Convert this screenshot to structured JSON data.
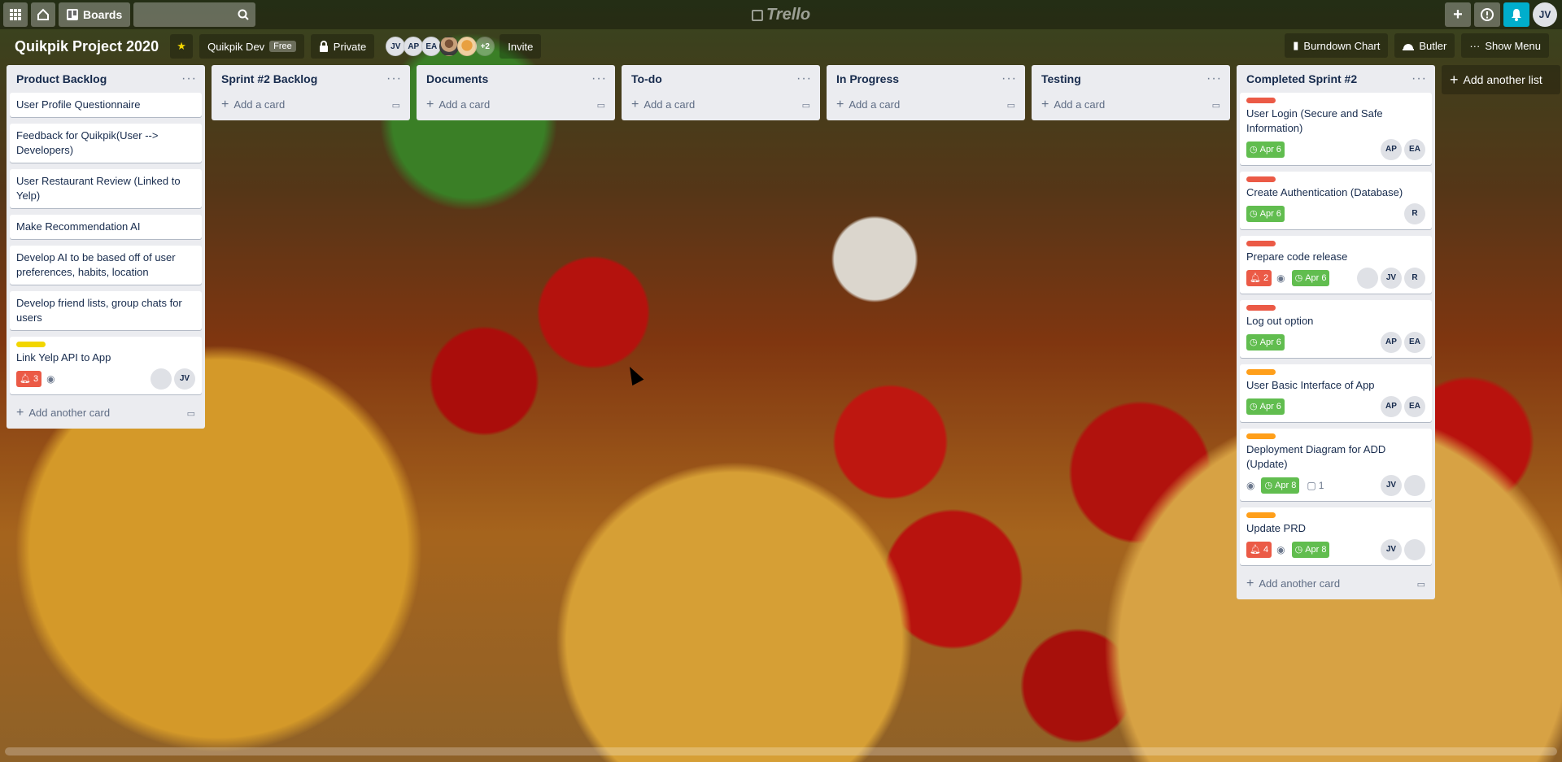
{
  "header": {
    "boards_label": "Boards",
    "logo_text": "Trello",
    "user_initials": "JV"
  },
  "board": {
    "title": "Quikpik Project 2020",
    "team": "Quikpik Dev",
    "team_badge": "Free",
    "visibility": "Private",
    "members": [
      "JV",
      "AP",
      "EA"
    ],
    "members_more": "+2",
    "invite_label": "Invite",
    "burndown_label": "Burndown Chart",
    "butler_label": "Butler",
    "show_menu_label": "Show Menu"
  },
  "add_list_label": "Add another list",
  "lists": [
    {
      "title": "Product Backlog",
      "cards": [
        {
          "title": "User Profile Questionnaire"
        },
        {
          "title": "Feedback for Quikpik(User --> Developers)"
        },
        {
          "title": "User Restaurant Review (Linked to Yelp)"
        },
        {
          "title": "Make Recommendation AI"
        },
        {
          "title": "Develop AI to be based off of user preferences, habits, location"
        },
        {
          "title": "Develop friend lists, group chats for users"
        },
        {
          "title": "Link Yelp API to App",
          "label_color": "#f2d600",
          "notifications": "3",
          "watching": true,
          "members": [
            "photo",
            "JV"
          ]
        }
      ],
      "add_label": "Add another card"
    },
    {
      "title": "Sprint #2 Backlog",
      "cards": [],
      "add_label": "Add a card"
    },
    {
      "title": "Documents",
      "cards": [],
      "add_label": "Add a card"
    },
    {
      "title": "To-do",
      "cards": [],
      "add_label": "Add a card"
    },
    {
      "title": "In Progress",
      "cards": [],
      "add_label": "Add a card"
    },
    {
      "title": "Testing",
      "cards": [],
      "add_label": "Add a card"
    },
    {
      "title": "Completed Sprint #2",
      "cards": [
        {
          "title": "User Login (Secure and Safe Information)",
          "label_color": "#eb5a46",
          "due": "Apr 6",
          "members": [
            "AP",
            "EA"
          ]
        },
        {
          "title": "Create Authentication (Database)",
          "label_color": "#eb5a46",
          "due": "Apr 6",
          "members": [
            "R"
          ]
        },
        {
          "title": "Prepare code release",
          "label_color": "#eb5a46",
          "notifications": "2",
          "watching": true,
          "due": "Apr 6",
          "members": [
            "photo",
            "JV",
            "R"
          ]
        },
        {
          "title": "Log out option",
          "label_color": "#eb5a46",
          "due": "Apr 6",
          "members": [
            "AP",
            "EA"
          ]
        },
        {
          "title": "User Basic Interface of App",
          "label_color": "#ff9f1a",
          "due": "Apr 6",
          "members": [
            "AP",
            "EA"
          ]
        },
        {
          "title": "Deployment Diagram for ADD (Update)",
          "label_color": "#ff9f1a",
          "watching": true,
          "due": "Apr 8",
          "comments": "1",
          "members": [
            "JV",
            "photo2"
          ]
        },
        {
          "title": "Update PRD",
          "label_color": "#ff9f1a",
          "notifications": "4",
          "watching": true,
          "due": "Apr 8",
          "members": [
            "JV",
            "photo2"
          ]
        }
      ],
      "add_label": "Add another card"
    }
  ]
}
